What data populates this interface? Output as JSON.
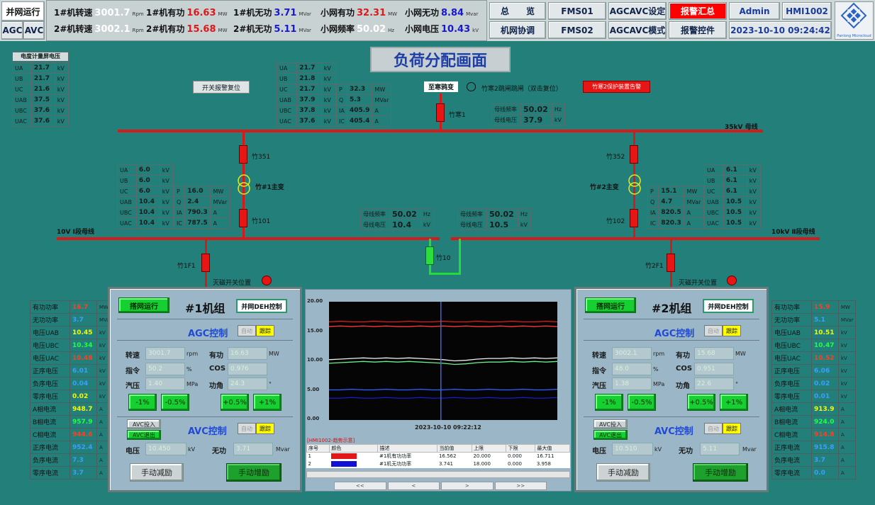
{
  "topbar": {
    "mode": "并网运行",
    "agc": "AGC",
    "avc": "AVC",
    "r1": [
      {
        "label": "1#机转速",
        "value": "3001.7",
        "unit": "Rpm",
        "color": "#ffffff"
      },
      {
        "label": "1#机有功",
        "value": "16.63",
        "unit": "MW",
        "color": "#e01818"
      },
      {
        "label": "1#机无功",
        "value": "3.71",
        "unit": "MVar",
        "color": "#1818d0"
      },
      {
        "label": "小网有功",
        "value": "32.31",
        "unit": "MW",
        "color": "#e01818"
      },
      {
        "label": "小网无功",
        "value": "8.84",
        "unit": "Mvar",
        "color": "#1818d0"
      }
    ],
    "r2": [
      {
        "label": "2#机转速",
        "value": "3002.1",
        "unit": "Rpm",
        "color": "#ffffff"
      },
      {
        "label": "2#机有功",
        "value": "15.68",
        "unit": "MW",
        "color": "#e01818"
      },
      {
        "label": "2#机无功",
        "value": "5.11",
        "unit": "MVar",
        "color": "#1818d0"
      },
      {
        "label": "小网频率",
        "value": "50.02",
        "unit": "Hz",
        "color": "#ffffff"
      },
      {
        "label": "小网电压",
        "value": "10.43",
        "unit": "kV",
        "color": "#1818d0"
      }
    ],
    "buttons": {
      "zonglan": "总　　览",
      "fms01": "FMS01",
      "agcavc_set": "AGCAVC设定",
      "alarm_sum": "报警汇总",
      "admin": "Admin",
      "hmi": "HMI1002",
      "jiwang": "机网协调",
      "fms02": "FMS02",
      "agcavc_mode": "AGCAVC模式",
      "alarm_ctrl": "报警控件",
      "datetime": "2023-10-10 09:24:42"
    },
    "logo_text": "Panlong Microcloud"
  },
  "page_title": "负荷分配画面",
  "reset_button": "开关报警复位",
  "meter_panel": {
    "title": "电度计量屏电压",
    "rows": [
      {
        "k": "UA",
        "v": "21.7",
        "u": "kV",
        "c": "yel"
      },
      {
        "k": "UB",
        "v": "21.7",
        "u": "kV",
        "c": "yel"
      },
      {
        "k": "UC",
        "v": "21.6",
        "u": "kV",
        "c": "red"
      },
      {
        "k": "UAB",
        "v": "37.5",
        "u": "kV",
        "c": "yel"
      },
      {
        "k": "UBC",
        "v": "37.6",
        "u": "kV",
        "c": "yel"
      },
      {
        "k": "UAC",
        "v": "37.6",
        "u": "kV",
        "c": "red"
      }
    ]
  },
  "top_table": {
    "left": [
      {
        "k": "UA",
        "v": "21.7",
        "u": "kV",
        "c": "yel"
      },
      {
        "k": "UB",
        "v": "21.8",
        "u": "kV",
        "c": "grn"
      },
      {
        "k": "UC",
        "v": "21.7",
        "u": "kV",
        "c": "red"
      },
      {
        "k": "UAB",
        "v": "37.9",
        "u": "kV",
        "c": "yel"
      },
      {
        "k": "UBC",
        "v": "37.8",
        "u": "kV",
        "c": "grn"
      },
      {
        "k": "UAC",
        "v": "37.6",
        "u": "kV",
        "c": "red"
      }
    ],
    "right": [
      {
        "k": "P",
        "v": "32.3",
        "u": "MW",
        "c": "red"
      },
      {
        "k": "Q",
        "v": "5.3",
        "u": "MVar",
        "c": "blu"
      },
      {
        "k": "IA",
        "v": "405.9",
        "u": "A",
        "c": "yel"
      },
      {
        "k": "IC",
        "v": "405.4",
        "u": "A",
        "c": "red"
      }
    ]
  },
  "transformer_label": "至寒鸦变",
  "trip_text": "竹寒2跳闸跳闸（双击复位）",
  "trip_alarm": "竹寒2保护装置告警",
  "bus35": {
    "freq_label": "母线频率",
    "freq": "50.02",
    "freq_unit": "Hz",
    "volt_label": "母线电压",
    "volt": "37.9",
    "volt_unit": "kV",
    "name": "35kV 母线"
  },
  "labels": {
    "zhuhan1": "竹寒1",
    "z351": "竹351",
    "z352": "竹352",
    "t1": "竹#1主变",
    "t2": "竹#2主变",
    "z101": "竹101",
    "z102": "竹102",
    "bus10_1": "10V Ⅰ段母线",
    "bus10_2": "10kV Ⅱ段母线",
    "z10": "竹10",
    "z1f1": "竹1F1",
    "z2f1": "竹2F1",
    "mag1": "灭磁开关位置",
    "mag2": "灭磁开关位置"
  },
  "t1_table": {
    "left": [
      {
        "k": "UA",
        "v": "6.0",
        "u": "kV",
        "c": "yel"
      },
      {
        "k": "UB",
        "v": "6.0",
        "u": "kV",
        "c": "yel"
      },
      {
        "k": "UC",
        "v": "6.0",
        "u": "kV",
        "c": "red"
      },
      {
        "k": "UAB",
        "v": "10.4",
        "u": "kV",
        "c": "yel"
      },
      {
        "k": "UBC",
        "v": "10.4",
        "u": "kV",
        "c": "yel"
      },
      {
        "k": "UAC",
        "v": "10.4",
        "u": "kV",
        "c": "red"
      }
    ],
    "right": [
      {
        "k": "P",
        "v": "16.0",
        "u": "MW",
        "c": "red"
      },
      {
        "k": "Q",
        "v": "2.4",
        "u": "MVar",
        "c": "blu"
      },
      {
        "k": "IA",
        "v": "790.3",
        "u": "A",
        "c": "yel"
      },
      {
        "k": "IC",
        "v": "787.5",
        "u": "A",
        "c": "red"
      }
    ]
  },
  "t2_table": {
    "left": [
      {
        "k": "P",
        "v": "15.1",
        "u": "MW",
        "c": "red"
      },
      {
        "k": "Q",
        "v": "4.7",
        "u": "MVar",
        "c": "blu"
      },
      {
        "k": "IA",
        "v": "820.5",
        "u": "A",
        "c": "yel"
      },
      {
        "k": "IC",
        "v": "820.3",
        "u": "A",
        "c": "red"
      }
    ],
    "right": [
      {
        "k": "UA",
        "v": "6.1",
        "u": "kV",
        "c": "yel"
      },
      {
        "k": "UB",
        "v": "6.1",
        "u": "kV",
        "c": "yel"
      },
      {
        "k": "UC",
        "v": "6.1",
        "u": "kV",
        "c": "red"
      },
      {
        "k": "UAB",
        "v": "10.5",
        "u": "kV",
        "c": "yel"
      },
      {
        "k": "UBC",
        "v": "10.5",
        "u": "kV",
        "c": "yel"
      },
      {
        "k": "UAC",
        "v": "10.5",
        "u": "kV",
        "c": "red"
      }
    ]
  },
  "bus10_1": {
    "freq_label": "母线频率",
    "freq": "50.02",
    "freq_unit": "Hz",
    "volt_label": "母线电压",
    "volt": "10.4",
    "volt_unit": "kV"
  },
  "bus10_2": {
    "freq_label": "母线频率",
    "freq": "50.02",
    "freq_unit": "Hz",
    "volt_label": "母线电压",
    "volt": "10.5",
    "volt_unit": "kV"
  },
  "side_left": [
    {
      "k": "有功功率",
      "v": "16.7",
      "u": "MW",
      "c": "red"
    },
    {
      "k": "无功功率",
      "v": "3.7",
      "u": "MVar",
      "c": "blu"
    },
    {
      "k": "电压UAB",
      "v": "10.45",
      "u": "kV",
      "c": "yel"
    },
    {
      "k": "电压UBC",
      "v": "10.34",
      "u": "kV",
      "c": "grn"
    },
    {
      "k": "电压UAC",
      "v": "10.48",
      "u": "kV",
      "c": "red"
    },
    {
      "k": "正序电压",
      "v": "6.01",
      "u": "kV",
      "c": "blu"
    },
    {
      "k": "负序电压",
      "v": "0.04",
      "u": "kV",
      "c": "blu"
    },
    {
      "k": "零序电压",
      "v": "0.02",
      "u": "kV",
      "c": "yel"
    },
    {
      "k": "A相电流",
      "v": "948.7",
      "u": "A",
      "c": "yel"
    },
    {
      "k": "B相电流",
      "v": "957.9",
      "u": "A",
      "c": "grn"
    },
    {
      "k": "C相电流",
      "v": "944.6",
      "u": "A",
      "c": "red"
    },
    {
      "k": "正序电流",
      "v": "952.4",
      "u": "A",
      "c": "blu"
    },
    {
      "k": "负序电流",
      "v": "7.3",
      "u": "A",
      "c": "blu"
    },
    {
      "k": "零序电流",
      "v": "3.7",
      "u": "A",
      "c": "blu"
    }
  ],
  "side_right": [
    {
      "k": "有功功率",
      "v": "15.9",
      "u": "MW",
      "c": "red"
    },
    {
      "k": "无功功率",
      "v": "5.1",
      "u": "MVar",
      "c": "blu"
    },
    {
      "k": "电压UAB",
      "v": "10.51",
      "u": "kV",
      "c": "yel"
    },
    {
      "k": "电压UBC",
      "v": "10.47",
      "u": "kV",
      "c": "grn"
    },
    {
      "k": "电压UAC",
      "v": "10.52",
      "u": "kV",
      "c": "red"
    },
    {
      "k": "正序电压",
      "v": "6.06",
      "u": "kV",
      "c": "blu"
    },
    {
      "k": "负序电压",
      "v": "0.02",
      "u": "kV",
      "c": "blu"
    },
    {
      "k": "零序电压",
      "v": "0.01",
      "u": "kV",
      "c": "blu"
    },
    {
      "k": "A相电流",
      "v": "913.9",
      "u": "A",
      "c": "yel"
    },
    {
      "k": "B相电流",
      "v": "924.0",
      "u": "A",
      "c": "grn"
    },
    {
      "k": "C相电流",
      "v": "914.8",
      "u": "A",
      "c": "red"
    },
    {
      "k": "正序电流",
      "v": "915.8",
      "u": "A",
      "c": "blu"
    },
    {
      "k": "负序电流",
      "v": "3.7",
      "u": "A",
      "c": "blu"
    },
    {
      "k": "零序电流",
      "v": "0.0",
      "u": "A",
      "c": "blu"
    }
  ],
  "unit1": {
    "run": "搭网运行",
    "title": "#1机组",
    "deh": "并网DEH控制",
    "agc": "AGC控制",
    "avc": "AVC控制",
    "auto": "自动",
    "track": "跟踪",
    "speed_l": "转速",
    "speed": "3001.7",
    "speed_u": "rpm",
    "cmd_l": "指令",
    "cmd": "50.2",
    "cmd_u": "%",
    "steam_l": "汽压",
    "steam": "1.40",
    "steam_u": "MPa",
    "p_l": "有功",
    "p": "16.63",
    "p_u": "MW",
    "cos_l": "COS θ",
    "cos": "0.976",
    "ang_l": "功角",
    "ang": "24.3",
    "ang_u": "°",
    "b1": "-1%",
    "b2": "-0.5%",
    "b3": "+0.5%",
    "b4": "+1%",
    "avc_in": "AVC投入",
    "avc_out": "AVC退出",
    "v_l": "电压",
    "v": "10.450",
    "v_u": "kV",
    "q_l": "无功",
    "q": "3.71",
    "q_u": "Mvar",
    "dec": "手动减励",
    "inc": "手动增励"
  },
  "unit2": {
    "run": "搭网运行",
    "title": "#2机组",
    "deh": "并网DEH控制",
    "agc": "AGC控制",
    "avc": "AVC控制",
    "auto": "自动",
    "track": "跟踪",
    "speed_l": "转速",
    "speed": "3002.1",
    "speed_u": "rpm",
    "cmd_l": "指令",
    "cmd": "48.0",
    "cmd_u": "%",
    "steam_l": "汽压",
    "steam": "1.38",
    "steam_u": "MPa",
    "p_l": "有功",
    "p": "15.68",
    "p_u": "MW",
    "cos_l": "COS θ",
    "cos": "0.951",
    "ang_l": "功角",
    "ang": "22.6",
    "ang_u": "°",
    "b1": "-1%",
    "b2": "-0.5%",
    "b3": "+0.5%",
    "b4": "+1%",
    "avc_in": "AVC投入",
    "avc_out": "AVC退出",
    "v_l": "电压",
    "v": "10.510",
    "v_u": "kV",
    "q_l": "无功",
    "q": "5.11",
    "q_u": "Mvar",
    "dec": "手动减励",
    "inc": "手动增励"
  },
  "trend": {
    "timestamp": "2023-10-10 09:22:12",
    "title": "[HMI1002-趋势示意]",
    "y_ticks": [
      "20.00",
      "15.00",
      "10.00",
      "5.00",
      "0.00"
    ],
    "table_headers": [
      "序号",
      "颜色",
      "描述",
      "当前值",
      "上限",
      "下限",
      "最大值"
    ],
    "rows": [
      {
        "no": "1",
        "color": "#e01818",
        "desc": "#1机有功功率",
        "cur": "16.562",
        "hi": "20.000",
        "lo": "0.000",
        "max": "16.711"
      },
      {
        "no": "2",
        "color": "#1010d8",
        "desc": "#1机无功功率",
        "cur": "3.741",
        "hi": "18.000",
        "lo": "0.000",
        "max": "3.958"
      }
    ],
    "nav": [
      "<<",
      "<",
      ">",
      ">>"
    ]
  },
  "chart_data": {
    "type": "line",
    "ylim": [
      0,
      20
    ],
    "x": [
      0,
      1,
      2,
      3,
      4,
      5,
      6,
      7,
      8,
      9,
      10,
      11,
      12,
      13,
      14,
      15,
      16,
      17,
      18,
      19,
      20
    ],
    "series": [
      {
        "color": "#e01818",
        "values": [
          16.6,
          16.7,
          16.6,
          16.6,
          16.7,
          16.6,
          16.6,
          16.7,
          16.6,
          16.6,
          16.7,
          16.6,
          16.6,
          16.7,
          16.6,
          16.6,
          16.7,
          16.6,
          16.6,
          16.7,
          16.6
        ]
      },
      {
        "color": "#ff3a3a",
        "values": [
          15.8,
          15.9,
          15.8,
          15.9,
          15.8,
          15.9,
          15.8,
          15.8,
          15.9,
          15.8,
          15.9,
          15.8,
          15.9,
          15.8,
          15.8,
          15.9,
          15.8,
          15.9,
          15.8,
          15.9,
          15.8
        ]
      },
      {
        "color": "#f0f0f0",
        "values": [
          10.2,
          10.3,
          10.4,
          10.5,
          10.4,
          10.5,
          10.4,
          10.5,
          10.4,
          10.3,
          10.2,
          10.0,
          10.1,
          10.3,
          10.4,
          10.4,
          10.5,
          10.4,
          10.5,
          10.4,
          10.5
        ]
      },
      {
        "color": "#6ef08a",
        "values": [
          9.6,
          9.7,
          9.8,
          9.9,
          9.8,
          9.9,
          9.8,
          9.9,
          9.8,
          9.7,
          9.6,
          9.4,
          9.5,
          9.7,
          9.8,
          9.8,
          9.9,
          9.8,
          9.9,
          9.8,
          9.9
        ]
      },
      {
        "color": "#2b5cff",
        "values": [
          5.1,
          5.1,
          5.2,
          5.1,
          5.1,
          5.2,
          5.1,
          5.1,
          5.2,
          5.1,
          5.1,
          5.2,
          5.1,
          5.1,
          5.2,
          5.1,
          5.1,
          5.2,
          5.1,
          5.1,
          5.2
        ]
      },
      {
        "color": "#1a1ad0",
        "values": [
          3.7,
          3.7,
          3.8,
          3.7,
          3.7,
          3.8,
          3.7,
          3.7,
          3.8,
          3.7,
          3.7,
          3.8,
          3.7,
          3.7,
          3.8,
          3.7,
          3.7,
          3.8,
          3.7,
          3.7,
          3.8
        ]
      }
    ]
  }
}
